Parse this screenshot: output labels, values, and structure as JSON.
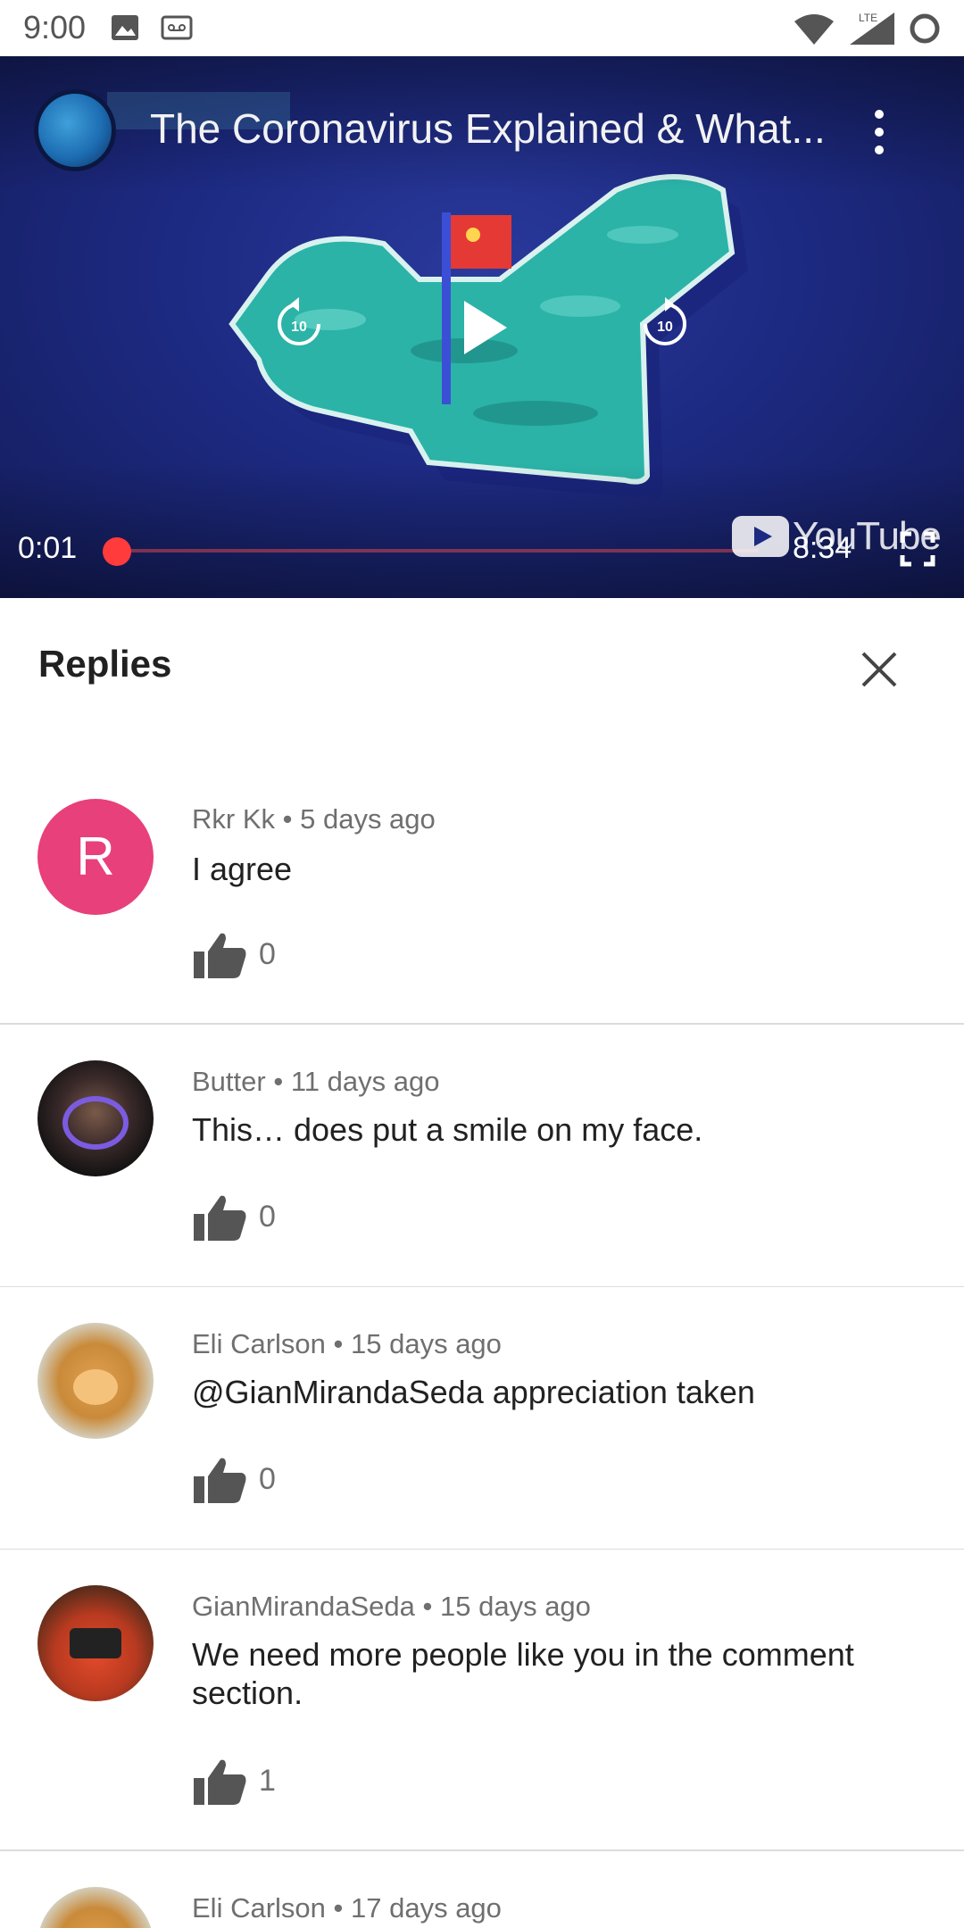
{
  "status_bar": {
    "time": "9:00",
    "icons": [
      "image-icon",
      "voicemail-icon",
      "wifi-icon",
      "lte-signal-icon",
      "ring-icon"
    ],
    "network_label": "LTE"
  },
  "player": {
    "title": "The Coronavirus Explained & What...",
    "current_time": "0:01",
    "total_time": "8:34",
    "progress": 0.002,
    "controls": [
      "rewind-10-icon",
      "play-icon",
      "forward-10-icon",
      "more-vert-icon",
      "fullscreen-icon"
    ],
    "skip_seconds": "10",
    "logo_text": "YouTube"
  },
  "panel": {
    "title": "Replies",
    "close_icon": "close-icon"
  },
  "replies": [
    {
      "author": "Rkr Kk",
      "separator": "•",
      "age": "5 days ago",
      "text": "I agree",
      "likes": "0",
      "avatar_letter": "R",
      "avatar_color": "#e8407a"
    },
    {
      "author": "Butter",
      "separator": "•",
      "age": "11 days ago",
      "text": "This… does put a smile on my face.",
      "likes": "0"
    },
    {
      "author": "Eli Carlson",
      "separator": "•",
      "age": "15 days ago",
      "text": "@GianMirandaSeda appreciation taken",
      "likes": "0"
    },
    {
      "author": "GianMirandaSeda",
      "separator": "•",
      "age": "15 days ago",
      "text": "We need more people like you in the comment section.",
      "likes": "1"
    },
    {
      "author": "Eli Carlson",
      "separator": "•",
      "age": "17 days ago",
      "text": "",
      "likes": ""
    }
  ],
  "colors": {
    "accent_red": "#ff3b3b",
    "player_bg": "#1d2a82",
    "map_teal": "#2bb3a8"
  }
}
